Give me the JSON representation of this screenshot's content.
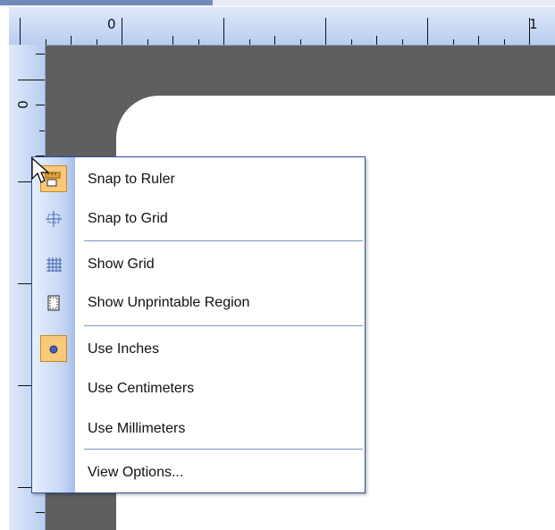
{
  "ruler": {
    "top_labels": [
      "0",
      "1"
    ],
    "side_labels": [
      "0"
    ]
  },
  "menu": {
    "items": [
      {
        "label": "Snap to Ruler",
        "icon": "ruler-snap-icon",
        "checked": true
      },
      {
        "label": "Snap to Grid",
        "icon": "grid-snap-icon",
        "checked": false
      },
      {
        "label": "Show Grid",
        "icon": "grid-icon",
        "checked": false
      },
      {
        "label": "Show Unprintable Region",
        "icon": "unprintable-region-icon",
        "checked": false
      },
      {
        "label": "Use Inches",
        "icon": "radio-dot-icon",
        "checked": true
      },
      {
        "label": "Use Centimeters",
        "icon": "",
        "checked": false
      },
      {
        "label": "Use Millimeters",
        "icon": "",
        "checked": false
      },
      {
        "label": "View Options...",
        "icon": "",
        "checked": false
      }
    ]
  },
  "colors": {
    "menu_border": "#2b4f9e",
    "checked_highlight": "#f7c978",
    "canvas": "#5f5f5f"
  }
}
